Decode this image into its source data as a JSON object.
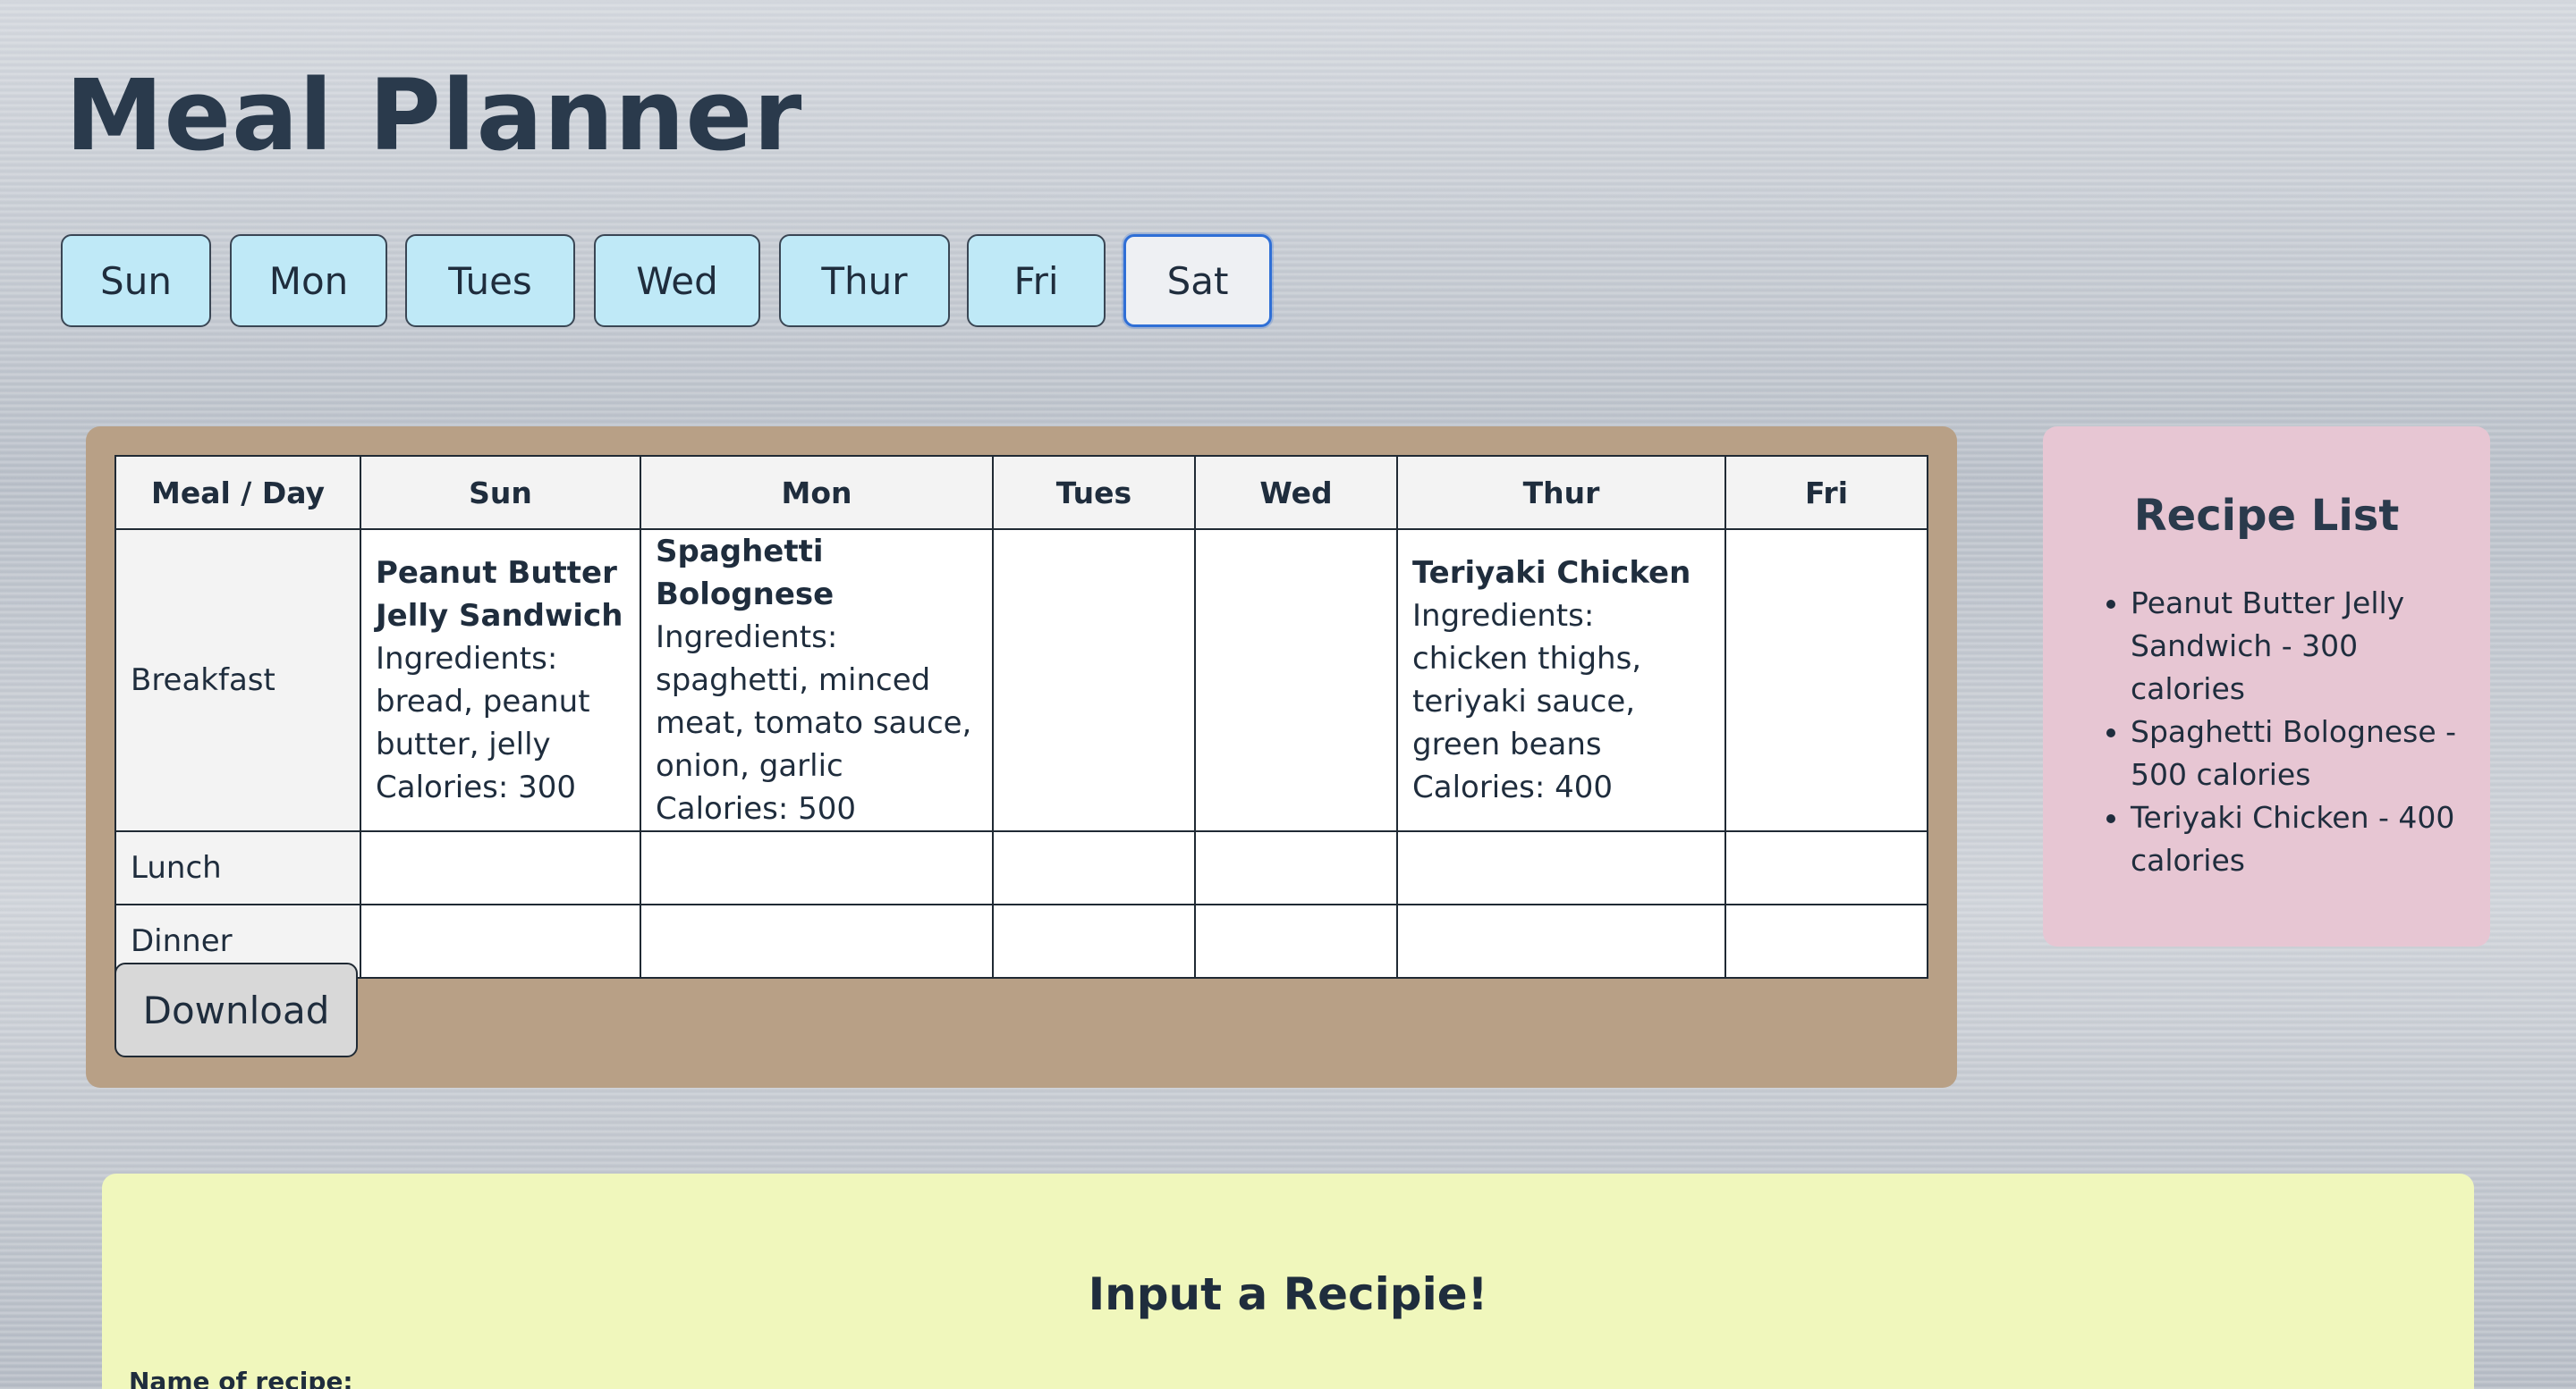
{
  "app": {
    "title": "Meal Planner"
  },
  "day_nav": {
    "days": [
      "Sun",
      "Mon",
      "Tues",
      "Wed",
      "Thur",
      "Fri",
      "Sat"
    ],
    "selected": "Sat"
  },
  "planner": {
    "corner_header": "Meal / Day",
    "columns": [
      "Sun",
      "Mon",
      "Tues",
      "Wed",
      "Thur",
      "Fri"
    ],
    "rows": {
      "breakfast": {
        "label": "Breakfast",
        "cells": {
          "sun": {
            "name": "Peanut Butter Jelly Sandwich",
            "ingredients": "Ingredients: bread, peanut butter, jelly",
            "calories": "Calories: 300"
          },
          "mon": {
            "name": "Spaghetti Bolognese",
            "ingredients": "Ingredients: spaghetti, minced meat, tomato sauce, onion, garlic",
            "calories": "Calories: 500"
          },
          "thur": {
            "name": "Teriyaki Chicken",
            "ingredients": "Ingredients: chicken thighs, teriyaki sauce, green beans",
            "calories": "Calories: 400"
          }
        }
      },
      "lunch": {
        "label": "Lunch"
      },
      "dinner": {
        "label": "Dinner"
      }
    },
    "download_label": "Download"
  },
  "recipe_list": {
    "title": "Recipe List",
    "items": [
      "Peanut Butter Jelly Sandwich - 300 calories",
      "Spaghetti Bolognese - 500 calories",
      "Teriyaki Chicken - 400 calories"
    ]
  },
  "input_form": {
    "title": "Input a Recipie!",
    "name_label": "Name of recipe:"
  }
}
